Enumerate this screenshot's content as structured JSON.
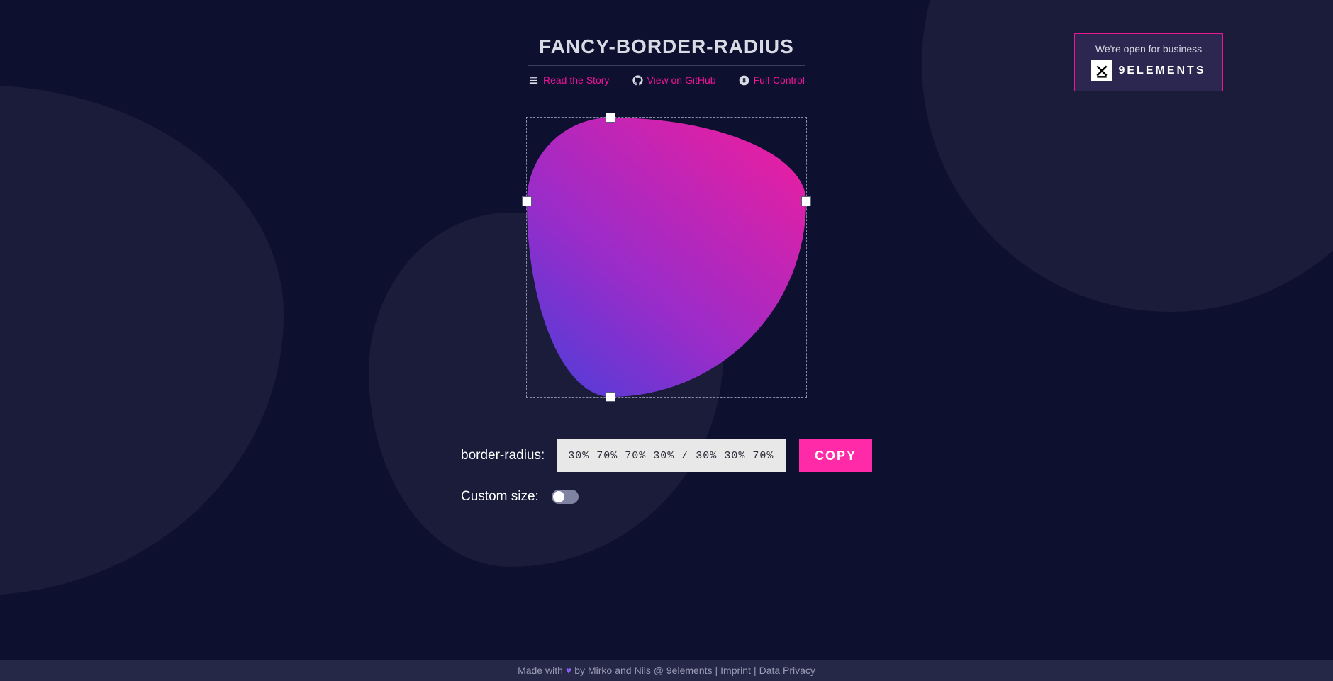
{
  "header": {
    "title": "FANCY-BORDER-RADIUS",
    "links": [
      {
        "label": "Read the Story",
        "icon": "read-icon"
      },
      {
        "label": "View on GitHub",
        "icon": "github-icon"
      },
      {
        "label": "Full-Control",
        "icon": "eight-icon"
      }
    ]
  },
  "callout": {
    "text": "We're open for business",
    "brand": "9ELEMENTS"
  },
  "editor": {
    "border_radius_value": "30% 70% 70% 30% / 30% 30% 70% 70%",
    "handles": [
      "top",
      "right",
      "bottom",
      "left"
    ],
    "shape_gradient": {
      "from": "#5c3ad6",
      "to": "#e41fa3"
    }
  },
  "controls": {
    "radius_label": "border-radius:",
    "radius_value": "30% 70% 70% 30% / 30% 30% 70% 70%",
    "copy_label": "COPY",
    "custom_size_label": "Custom size:",
    "custom_size_on": false
  },
  "footer": {
    "prefix": "Made with",
    "by": "by",
    "author1": "Mirko",
    "and": "and",
    "author2": "Nils @ 9elements",
    "sep": " | ",
    "imprint": "Imprint",
    "privacy": "Data Privacy"
  }
}
